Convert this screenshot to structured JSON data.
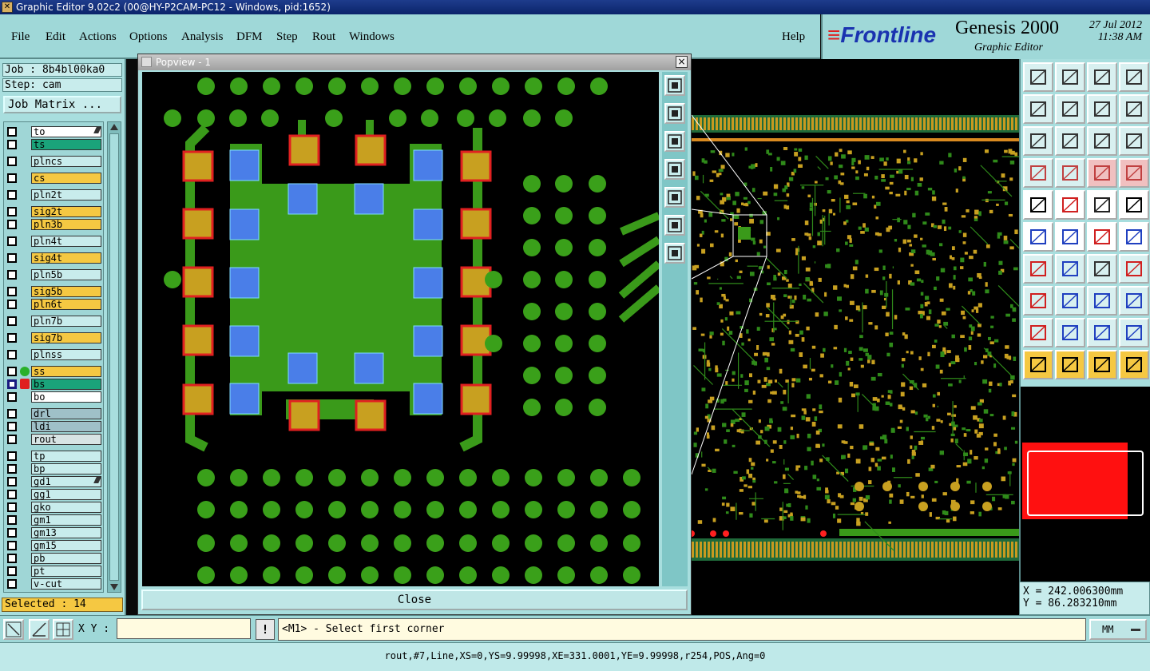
{
  "window": {
    "title": "Graphic Editor 9.02c2 (00@HY-P2CAM-PC12 - Windows, pid:1652)"
  },
  "menu": [
    "File",
    "Edit",
    "Actions",
    "Options",
    "Analysis",
    "DFM",
    "Step",
    "Rout",
    "Windows"
  ],
  "help_label": "Help",
  "brand": {
    "logo_mark": "≡",
    "logo": "Frontline",
    "product": "Genesis 2000",
    "subtitle": "Graphic Editor",
    "date": "27 Jul 2012",
    "time": "11:38 AM"
  },
  "job": {
    "job": "Job : 8b4bl00ka0",
    "step": "Step: cam",
    "matrix_button": "Job Matrix ..."
  },
  "layers": [
    {
      "name": "to",
      "color": "#ffffff"
    },
    {
      "name": "ts",
      "color": "#1aa37a"
    },
    {
      "name": "plncs",
      "color": "#c8ecec"
    },
    {
      "name": "cs",
      "color": "#f5c842"
    },
    {
      "name": "pln2t",
      "color": "#c8ecec"
    },
    {
      "name": "sig2t",
      "color": "#f5c842"
    },
    {
      "name": "pln3b",
      "color": "#f5c842"
    },
    {
      "name": "pln4t",
      "color": "#c8ecec"
    },
    {
      "name": "sig4t",
      "color": "#f5c842"
    },
    {
      "name": "pln5b",
      "color": "#c8ecec"
    },
    {
      "name": "sig5b",
      "color": "#f5c842"
    },
    {
      "name": "pln6t",
      "color": "#f5c842"
    },
    {
      "name": "pln7b",
      "color": "#c8ecec"
    },
    {
      "name": "sig7b",
      "color": "#f5c842"
    },
    {
      "name": "plnss",
      "color": "#c8ecec"
    },
    {
      "name": "ss",
      "color": "#f5c842"
    },
    {
      "name": "bs",
      "color": "#1aa37a"
    },
    {
      "name": "bo",
      "color": "#ffffff"
    },
    {
      "name": "drl",
      "color": "#9fc0c8"
    },
    {
      "name": "ldi",
      "color": "#9fc0c8"
    },
    {
      "name": "rout",
      "color": "#d8e4e4"
    },
    {
      "name": "tp",
      "color": "#c8ecec"
    },
    {
      "name": "bp",
      "color": "#c8ecec"
    },
    {
      "name": "gd1",
      "color": "#c8ecec"
    },
    {
      "name": "gg1",
      "color": "#c8ecec"
    },
    {
      "name": "gko",
      "color": "#c8ecec"
    },
    {
      "name": "gm1",
      "color": "#c8ecec"
    },
    {
      "name": "gm13",
      "color": "#c8ecec"
    },
    {
      "name": "gm15",
      "color": "#c8ecec"
    },
    {
      "name": "pb",
      "color": "#c8ecec"
    },
    {
      "name": "pt",
      "color": "#c8ecec"
    },
    {
      "name": "v-cut",
      "color": "#c8ecec"
    }
  ],
  "selected": "Selected : 14",
  "popview": {
    "title": "Popview - 1",
    "close_x": "×",
    "close_label": "Close"
  },
  "coords": {
    "x": "X = 242.006300mm",
    "y": "Y = 86.283210mm"
  },
  "cmd": {
    "xy_label": "X Y :",
    "xy_value": "",
    "excl": "!",
    "prompt": "<M1> - Select first corner",
    "units": "MM"
  },
  "status": "rout,#7,Line,XS=0,YS=9.99998,XE=331.0001,YE=9.99998,r254,POS,Ang=0",
  "colors": {
    "panel": "#a8dede",
    "pad_gold": "#c8a020",
    "pad_red": "#e02020",
    "pad_blue": "#4a7ee8",
    "copper_green": "#3a9a1a",
    "via_green": "#3aa01a"
  }
}
